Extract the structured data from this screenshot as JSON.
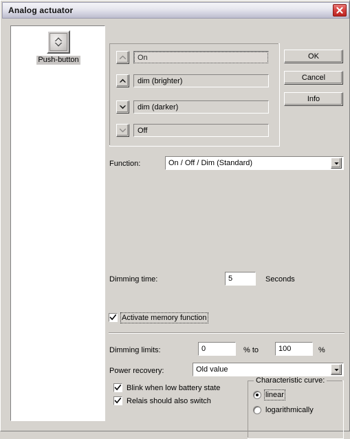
{
  "window": {
    "title": "Analog actuator",
    "close_icon": "close-icon"
  },
  "device_panel": {
    "item": {
      "label": "Push-button",
      "icon": "push-button-icon",
      "selected": true
    }
  },
  "list_group": {
    "rows": [
      {
        "arrow_icon": "chevron-up-light-icon",
        "label": "On",
        "focused": true
      },
      {
        "arrow_icon": "chevron-up-bold-icon",
        "label": "dim (brighter)",
        "focused": false
      },
      {
        "arrow_icon": "chevron-down-bold-icon",
        "label": "dim (darker)",
        "focused": false
      },
      {
        "arrow_icon": "chevron-down-light-icon",
        "label": "Off",
        "focused": false
      }
    ]
  },
  "command_buttons": {
    "ok": "OK",
    "cancel": "Cancel",
    "info": "Info"
  },
  "function_row": {
    "label": "Function:",
    "value": "On / Off / Dim (Standard)",
    "dropdown_icon": "chevron-down-icon"
  },
  "dimming_time": {
    "label": "Dimming time:",
    "value": "5",
    "unit": "Seconds"
  },
  "memory_function": {
    "label": "Activate memory function",
    "checked": true,
    "check_icon": "check-icon"
  },
  "dimming_limits": {
    "label": "Dimming limits:",
    "min_value": "0",
    "percent_to": "% to",
    "max_value": "100",
    "percent": "%"
  },
  "power_recovery": {
    "label": "Power recovery:",
    "value": "Old value",
    "dropdown_icon": "chevron-down-icon"
  },
  "options": [
    {
      "label": "Blink when low battery state",
      "checked": true
    },
    {
      "label": "Relais should also switch",
      "checked": true
    }
  ],
  "characteristic_curve": {
    "title": "Characteristic curve:",
    "options": [
      {
        "label": "linear",
        "selected": true
      },
      {
        "label": "logarithmically",
        "selected": false
      }
    ]
  },
  "colors": {
    "face": "#d6d3ce",
    "close_red": "#d64442",
    "field_white": "#ffffff",
    "shadow": "#808080"
  }
}
